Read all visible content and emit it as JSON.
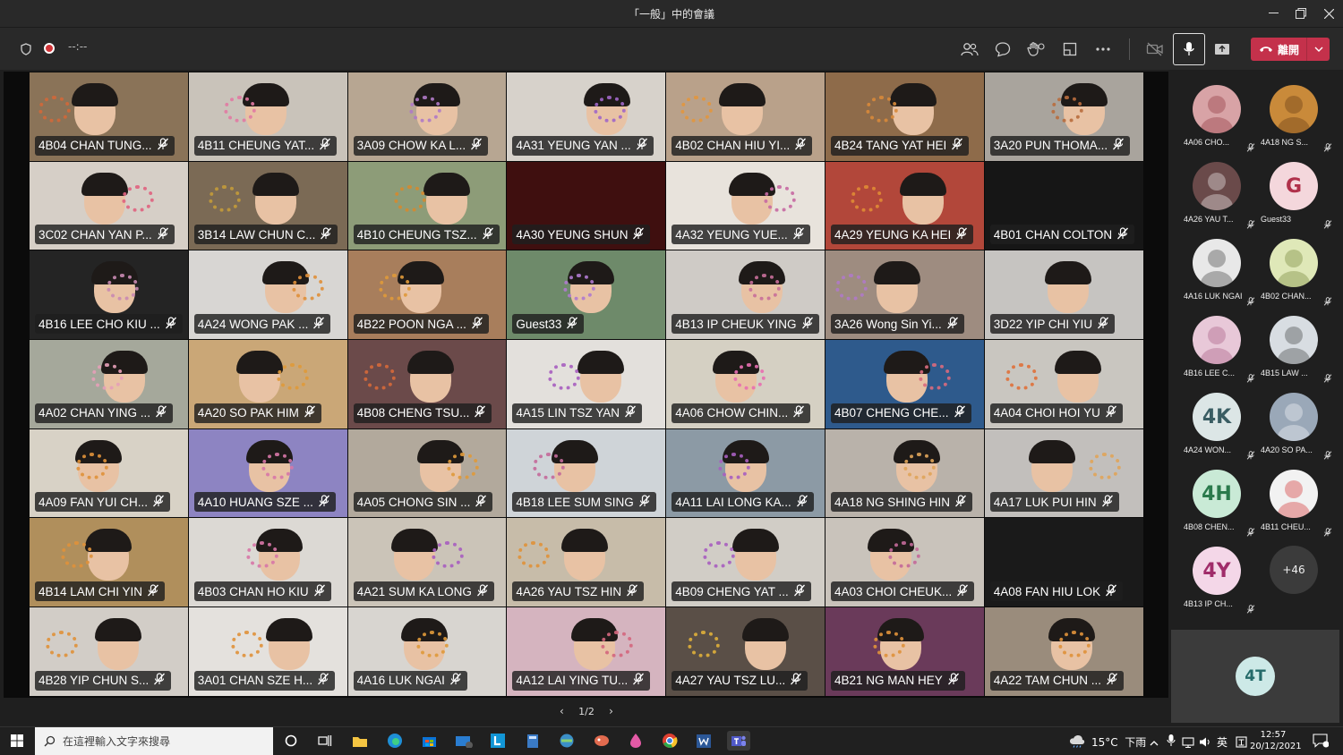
{
  "window": {
    "title": "「一般」中的會議"
  },
  "toolbar": {
    "timer": "--:--",
    "leave_label": "離開"
  },
  "grid": {
    "participants": [
      {
        "name": "4B04 CHAN TUNG...",
        "bg": "#8a7358",
        "craft": "#d2683a"
      },
      {
        "name": "4B11 CHEUNG YAT...",
        "bg": "#c9c3ba",
        "craft": "#e27aa3"
      },
      {
        "name": "3A09 CHOW KA L...",
        "bg": "#b7a692",
        "craft": "#b07ac7"
      },
      {
        "name": "4A31 YEUNG YAN ...",
        "bg": "#d7d2cb",
        "craft": "#a067c8"
      },
      {
        "name": "4B02 CHAN HIU YI...",
        "bg": "#b9a18a",
        "craft": "#e3973e"
      },
      {
        "name": "4B24 TANG YAT HEI",
        "bg": "#8e6b4a",
        "craft": "#d98a3a"
      },
      {
        "name": "3A20 PUN THOMA...",
        "bg": "#a9a49d",
        "craft": "#b96d3e"
      },
      {
        "name": "3C02 CHAN YAN P...",
        "bg": "#d6cfc7",
        "craft": "#e06380"
      },
      {
        "name": "3B14 LAW CHUN C...",
        "bg": "#7b6a55",
        "craft": "#c49b3a"
      },
      {
        "name": "4B10 CHEUNG TSZ...",
        "bg": "#8d9c78",
        "craft": "#d48a2f"
      },
      {
        "name": "4A30 YEUNG SHUN",
        "bg": "#3f0f0f",
        "craft": "transparent"
      },
      {
        "name": "4A32 YEUNG YUE...",
        "bg": "#e8e3dc",
        "craft": "#c76aa3"
      },
      {
        "name": "4A29 YEUNG KA HEI",
        "bg": "#b2473a",
        "craft": "#e08b35"
      },
      {
        "name": "4B01 CHAN COLTON",
        "bg": "#161616",
        "craft": "transparent"
      },
      {
        "name": "4B16 LEE CHO KIU ...",
        "bg": "#242424",
        "craft": "#c98ab3"
      },
      {
        "name": "4A24 WONG PAK ...",
        "bg": "#d8d6d3",
        "craft": "#e0903a"
      },
      {
        "name": "4B22 POON NGA ...",
        "bg": "#a87e5c",
        "craft": "#e09a3a"
      },
      {
        "name": "Guest33",
        "bg": "#6e8a6a",
        "craft": "#b07ad0"
      },
      {
        "name": "4B13 IP CHEUK YING",
        "bg": "#cfcbc6",
        "craft": "#c86f9a"
      },
      {
        "name": "3A26 Wong Sin Yi...",
        "bg": "#9e8c80",
        "craft": "#b07ac7"
      },
      {
        "name": "3D22 YIP CHI YIU",
        "bg": "#c6c4c1",
        "craft": "transparent"
      },
      {
        "name": "4A02 CHAN YING ...",
        "bg": "#a5a89b",
        "craft": "#e6a0b8"
      },
      {
        "name": "4A20 SO PAK HIM",
        "bg": "#caa777",
        "craft": "#e09a3a"
      },
      {
        "name": "4B08 CHENG TSU...",
        "bg": "#6b4a4a",
        "craft": "#d66a3a"
      },
      {
        "name": "4A15 LIN TSZ YAN",
        "bg": "#e3e0dc",
        "craft": "#a85fc0"
      },
      {
        "name": "4A06 CHOW CHIN...",
        "bg": "#d5d0c3",
        "craft": "#e86fb1"
      },
      {
        "name": "4B07 CHENG CHE...",
        "bg": "#2e5a8c",
        "craft": "#d96b7e"
      },
      {
        "name": "4A04 CHOI HOI YU",
        "bg": "#c9c6c0",
        "craft": "#e0713a"
      },
      {
        "name": "4A09 FAN YUI CH...",
        "bg": "#d8d2c6",
        "craft": "#e0923a"
      },
      {
        "name": "4A10 HUANG SZE ...",
        "bg": "#8d84c2",
        "craft": "#d877a8"
      },
      {
        "name": "4A05 CHONG SIN ...",
        "bg": "#b2a99c",
        "craft": "#e09a3a"
      },
      {
        "name": "4B18 LEE SUM SING",
        "bg": "#cfd4d8",
        "craft": "#c46a9a"
      },
      {
        "name": "4A11 LAI LONG KA...",
        "bg": "#8c9aa5",
        "craft": "#a85fc0"
      },
      {
        "name": "4A18 NG SHING HIN",
        "bg": "#b9b2aa",
        "craft": "#e0a55a"
      },
      {
        "name": "4A17 LUK PUI HIN",
        "bg": "#c2bfbc",
        "craft": "#e0a55a"
      },
      {
        "name": "4B14 LAM CHI YIN",
        "bg": "#b08f5c",
        "craft": "#e0923a"
      },
      {
        "name": "4B03 CHAN HO KIU",
        "bg": "#dcd9d4",
        "craft": "#d877a8"
      },
      {
        "name": "4A21 SUM KA LONG",
        "bg": "#cbc4b8",
        "craft": "#a85fc0"
      },
      {
        "name": "4A26 YAU TSZ HIN",
        "bg": "#c7bca9",
        "craft": "#e0923a"
      },
      {
        "name": "4B09 CHENG YAT ...",
        "bg": "#d1cdc6",
        "craft": "#a85fc0"
      },
      {
        "name": "4A03 CHOI CHEUK...",
        "bg": "#c9c3bb",
        "craft": "#c46a9a"
      },
      {
        "name": "4A08 FAN HIU LOK",
        "bg": "#1a1a1a",
        "craft": "transparent"
      },
      {
        "name": "4B28 YIP CHUN S...",
        "bg": "#d2cdc7",
        "craft": "#e0923a"
      },
      {
        "name": "3A01 CHAN SZE H...",
        "bg": "#e4e1dd",
        "craft": "#e0923a"
      },
      {
        "name": "4A16 LUK NGAI",
        "bg": "#d8d5d0",
        "craft": "#e09a3a"
      },
      {
        "name": "4A12 LAI YING TU...",
        "bg": "#d5b4bf",
        "craft": "#d4677e"
      },
      {
        "name": "4A27 YAU TSZ LU...",
        "bg": "#5a4f47",
        "craft": "#e0b03a"
      },
      {
        "name": "4B21 NG MAN HEY",
        "bg": "#6a3a5a",
        "craft": "#e0923a"
      },
      {
        "name": "4A22 TAM CHUN ...",
        "bg": "#9a8c7c",
        "craft": "#e0923a"
      }
    ]
  },
  "pager": {
    "label": "1/2"
  },
  "rail": {
    "people": [
      {
        "caption": "4A06 CHO...",
        "initials": "",
        "bg": "#d8a3a6",
        "fg": "#8a2b35"
      },
      {
        "caption": "4A18 NG S...",
        "initials": "",
        "bg": "#c98a3a",
        "fg": "#5a3210"
      },
      {
        "caption": "4A26 YAU T...",
        "initials": "",
        "bg": "#6a4a4a",
        "fg": "#fff"
      },
      {
        "caption": "Guest33",
        "initials": "G",
        "bg": "#f4d7dc",
        "fg": "#b0304a"
      },
      {
        "caption": "4A16 LUK NGAI",
        "initials": "",
        "bg": "#e8e8e8",
        "fg": "#333"
      },
      {
        "caption": "4B02 CHAN...",
        "initials": "",
        "bg": "#dfe8b8",
        "fg": "#6a7a2a"
      },
      {
        "caption": "4B16 LEE C...",
        "initials": "",
        "bg": "#e8c8d8",
        "fg": "#a0507a"
      },
      {
        "caption": "4B15 LAW ...",
        "initials": "",
        "bg": "#d8dde2",
        "fg": "#333"
      },
      {
        "caption": "4A24 WON...",
        "initials": "4K",
        "bg": "#dce6e6",
        "fg": "#3a5d63"
      },
      {
        "caption": "4A20 SO PA...",
        "initials": "",
        "bg": "#9aa8b8",
        "fg": "#fff"
      },
      {
        "caption": "4B08 CHEN...",
        "initials": "4H",
        "bg": "#c9ead6",
        "fg": "#2a7a4c"
      },
      {
        "caption": "4B11 CHEU...",
        "initials": "",
        "bg": "#f2f2f2",
        "fg": "#d02020"
      },
      {
        "caption": "4B13 IP CH...",
        "initials": "4Y",
        "bg": "#f4d7e8",
        "fg": "#a02c6a"
      }
    ],
    "overflow_label": "+46",
    "self_initials": "4T"
  },
  "taskbar": {
    "search_placeholder": "在這裡輸入文字來搜尋",
    "weather": "15°C  下雨",
    "ime": "英",
    "time": "12:57",
    "date": "20/12/2021"
  },
  "colors": {
    "accent_leave": "#c4314b",
    "toolbar": "#292929",
    "stage": "#0b0b0b"
  }
}
